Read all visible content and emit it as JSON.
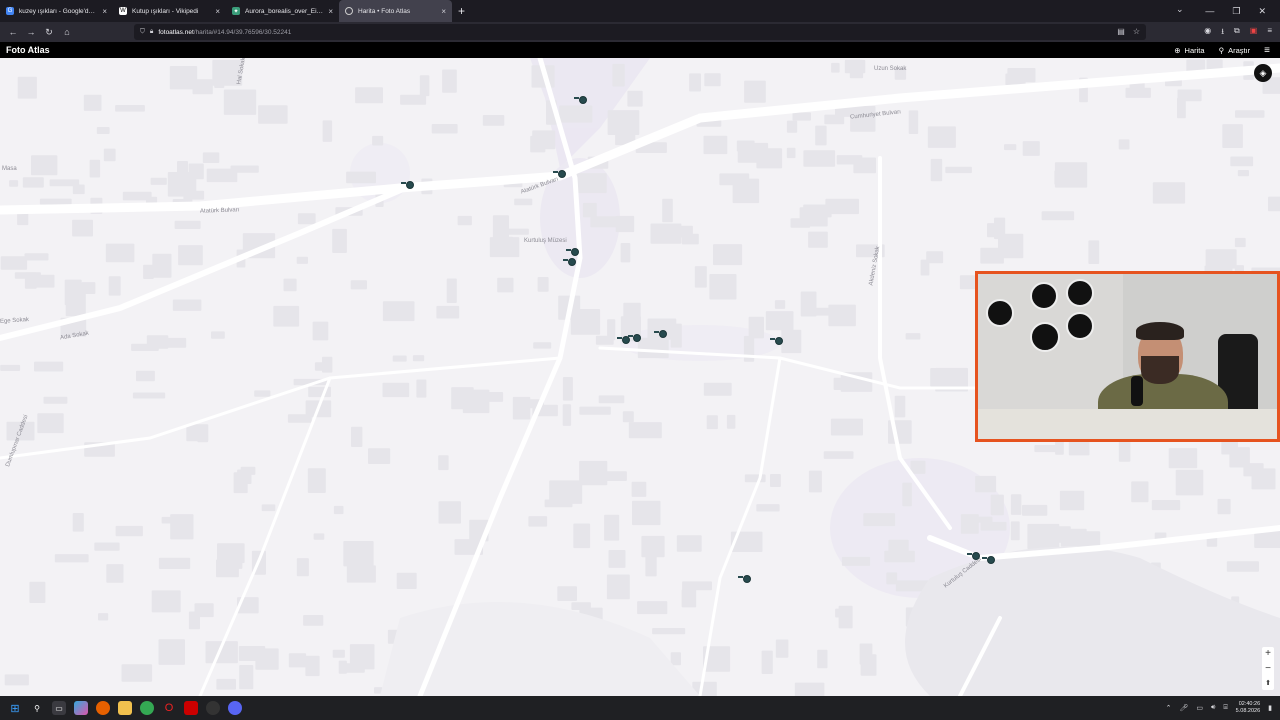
{
  "browser": {
    "tabs": [
      {
        "title": "kuzey ışıkları - Google'da Ara",
        "favicon": "google-icon",
        "color": "#4285f4"
      },
      {
        "title": "Kutup ışıkları - Vikipedi",
        "favicon": "wikipedia-icon",
        "color": "#ffffff"
      },
      {
        "title": "Aurora_borealis_over_Eielson_A",
        "favicon": "wikimedia-icon",
        "color": "#3a9d7a"
      },
      {
        "title": "Harita • Foto Atlas",
        "favicon": "globe-icon",
        "color": "#cccccc"
      }
    ],
    "active_tab": 3,
    "url_host": "fotoatlas.net",
    "url_path": "/harita/#14.94/39.76596/30.52241"
  },
  "site": {
    "brand": "Foto Atlas",
    "nav_map": "Harita",
    "nav_explore": "Araştır"
  },
  "map": {
    "streets": {
      "ataturk_bulvari_w": "Atatürk Bulvarı",
      "ataturk_bulvari_e": "Atatürk Bulvarı",
      "cumhuriyet_bulvari": "Cumhuriyet Bulvarı",
      "uzun_sokak": "Uzun Sokak",
      "ege_sokak": "Ege Sokak",
      "ada_sokak": "Ada Sokak",
      "kurtulus_caddesi": "Kurtuluş Caddesi",
      "kurtulus_muzesi": "Kurtuluş Müzesi",
      "akdeniz_sokak": "Akdeniz Sokak",
      "dumlupinar_caddesi": "Dumlupınar Caddesi",
      "hal_sokak": "Hal Sokak",
      "masa": "Masa"
    },
    "zoom_in": "+",
    "zoom_out": "−",
    "compass": "⬆"
  },
  "taskbar": {
    "time": "02:40:26",
    "date": "5.08.2026"
  }
}
